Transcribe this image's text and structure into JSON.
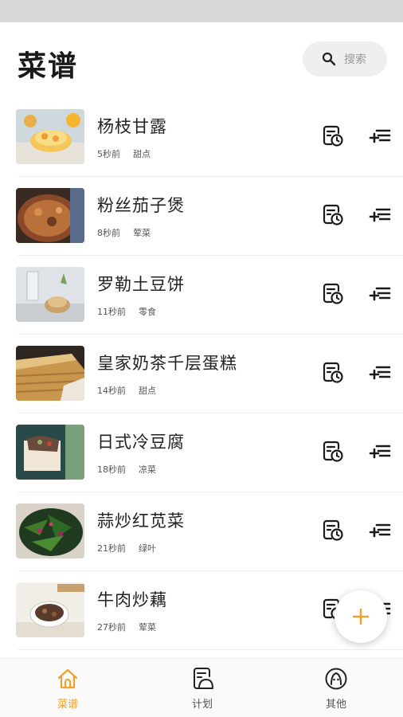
{
  "header": {
    "title": "菜谱"
  },
  "search": {
    "placeholder": "搜索"
  },
  "recipes": [
    {
      "name": "杨枝甘露",
      "time": "5秒前",
      "category": "甜点"
    },
    {
      "name": "粉丝茄子煲",
      "time": "8秒前",
      "category": "荤菜"
    },
    {
      "name": "罗勒土豆饼",
      "time": "11秒前",
      "category": "零食"
    },
    {
      "name": "皇家奶茶千层蛋糕",
      "time": "14秒前",
      "category": "甜点"
    },
    {
      "name": "日式冷豆腐",
      "time": "18秒前",
      "category": "凉菜"
    },
    {
      "name": "蒜炒红苋菜",
      "time": "21秒前",
      "category": "绿叶"
    },
    {
      "name": "牛肉炒藕",
      "time": "27秒前",
      "category": "荤菜"
    }
  ],
  "tabs": [
    {
      "label": "菜谱",
      "icon": "home-icon",
      "active": true
    },
    {
      "label": "计划",
      "icon": "plan-icon",
      "active": false
    },
    {
      "label": "其他",
      "icon": "profile-icon",
      "active": false
    }
  ],
  "colors": {
    "accent": "#f2a12f",
    "text": "#222222"
  },
  "fab": {
    "icon": "plus-icon"
  }
}
